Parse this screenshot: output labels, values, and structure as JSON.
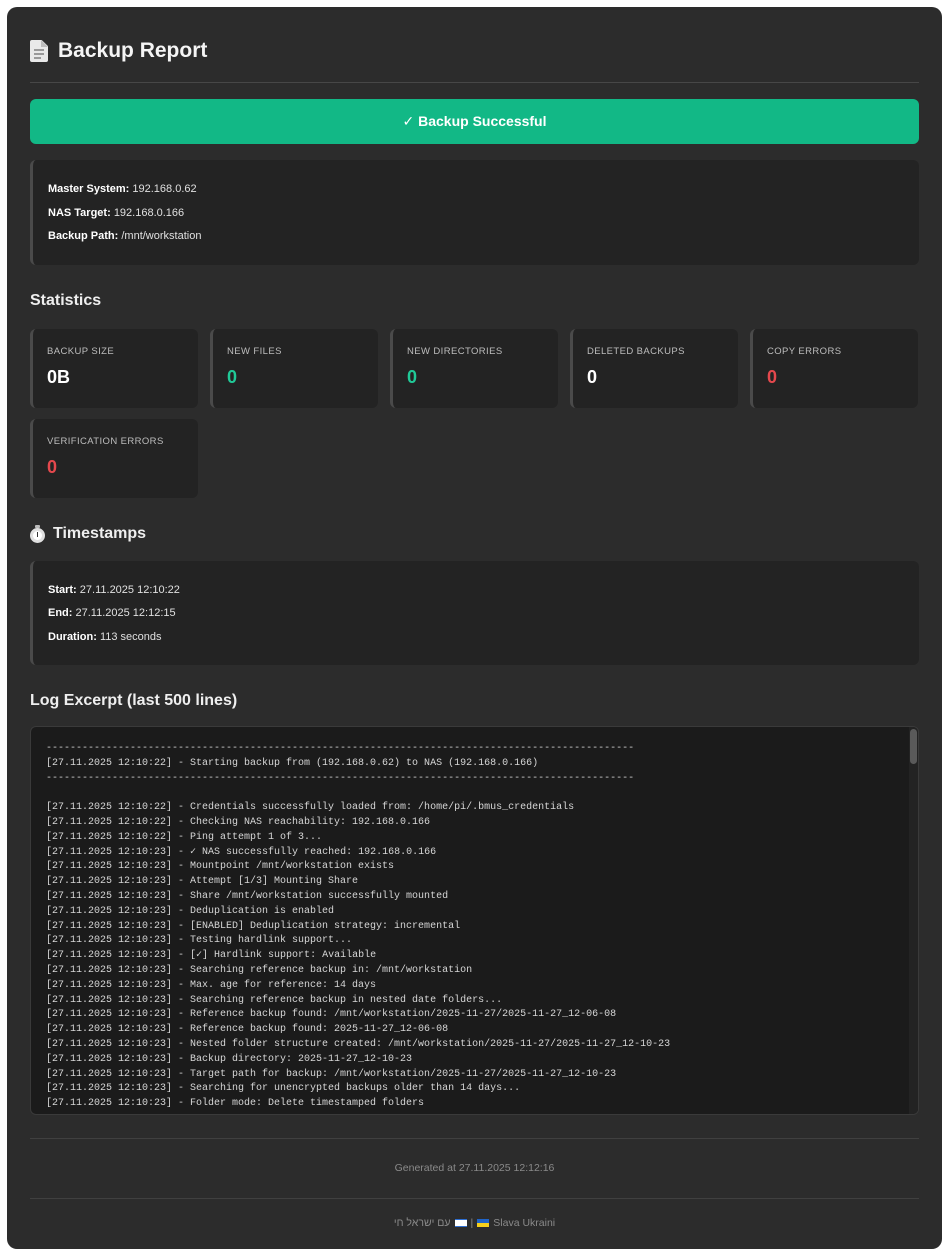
{
  "header": {
    "icon": "document-icon",
    "title": "Backup Report"
  },
  "status": {
    "label": "✓ Backup Successful",
    "color": "#12b886"
  },
  "systems": {
    "master_label": "Master System:",
    "master_value": "192.168.0.62",
    "nas_label": "NAS Target:",
    "nas_value": "192.168.0.166",
    "path_label": "Backup Path:",
    "path_value": "/mnt/workstation"
  },
  "statistics": {
    "title": "Statistics",
    "items": [
      {
        "label": "Backup Size",
        "value": "0B"
      },
      {
        "label": "New Files",
        "value": "0"
      },
      {
        "label": "New Directories",
        "value": "0"
      },
      {
        "label": "Deleted Backups",
        "value": "0"
      },
      {
        "label": "Copy Errors",
        "value": "0"
      },
      {
        "label": "Verification Errors",
        "value": "0"
      }
    ],
    "colors": {
      "neutral": "#ffffff",
      "success": "#20c997",
      "error": "#e5484d"
    }
  },
  "timestamps": {
    "icon": "stopwatch-icon",
    "title": "Timestamps",
    "start_label": "Start:",
    "start_value": "27.11.2025 12:10:22",
    "end_label": "End:",
    "end_value": "27.11.2025 12:12:15",
    "duration_label": "Duration:",
    "duration_value": "113 seconds"
  },
  "log": {
    "title": "Log Excerpt (last 500 lines)",
    "lines": [
      "--------------------------------------------------------------------------------------------------",
      "[27.11.2025 12:10:22] - Starting backup from (192.168.0.62) to NAS (192.168.0.166)",
      "--------------------------------------------------------------------------------------------------",
      "",
      "[27.11.2025 12:10:22] - Credentials successfully loaded from: /home/pi/.bmus_credentials",
      "[27.11.2025 12:10:22] - Checking NAS reachability: 192.168.0.166",
      "[27.11.2025 12:10:22] - Ping attempt 1 of 3...",
      "[27.11.2025 12:10:23] - ✓ NAS successfully reached: 192.168.0.166",
      "[27.11.2025 12:10:23] - Mountpoint /mnt/workstation exists",
      "[27.11.2025 12:10:23] - Attempt [1/3] Mounting Share",
      "[27.11.2025 12:10:23] - Share /mnt/workstation successfully mounted",
      "[27.11.2025 12:10:23] - Deduplication is enabled",
      "[27.11.2025 12:10:23] - [ENABLED] Deduplication strategy: incremental",
      "[27.11.2025 12:10:23] - Testing hardlink support...",
      "[27.11.2025 12:10:23] - [✓] Hardlink support: Available",
      "[27.11.2025 12:10:23] - Searching reference backup in: /mnt/workstation",
      "[27.11.2025 12:10:23] - Max. age for reference: 14 days",
      "[27.11.2025 12:10:23] - Searching reference backup in nested date folders...",
      "[27.11.2025 12:10:23] - Reference backup found: /mnt/workstation/2025-11-27/2025-11-27_12-06-08",
      "[27.11.2025 12:10:23] - Reference backup found: 2025-11-27_12-06-08",
      "[27.11.2025 12:10:23] - Nested folder structure created: /mnt/workstation/2025-11-27/2025-11-27_12-10-23",
      "[27.11.2025 12:10:23] - Backup directory: 2025-11-27_12-10-23",
      "[27.11.2025 12:10:23] - Target path for backup: /mnt/workstation/2025-11-27/2025-11-27_12-10-23",
      "[27.11.2025 12:10:23] - Searching for unencrypted backups older than 14 days...",
      "[27.11.2025 12:10:23] - Folder mode: Delete timestamped folders"
    ]
  },
  "footer": {
    "generated": "Generated at 27.11.2025 12:12:16",
    "hebrew": "עם ישראל חי",
    "separator": "|",
    "ukraine": "Slava Ukraini"
  }
}
